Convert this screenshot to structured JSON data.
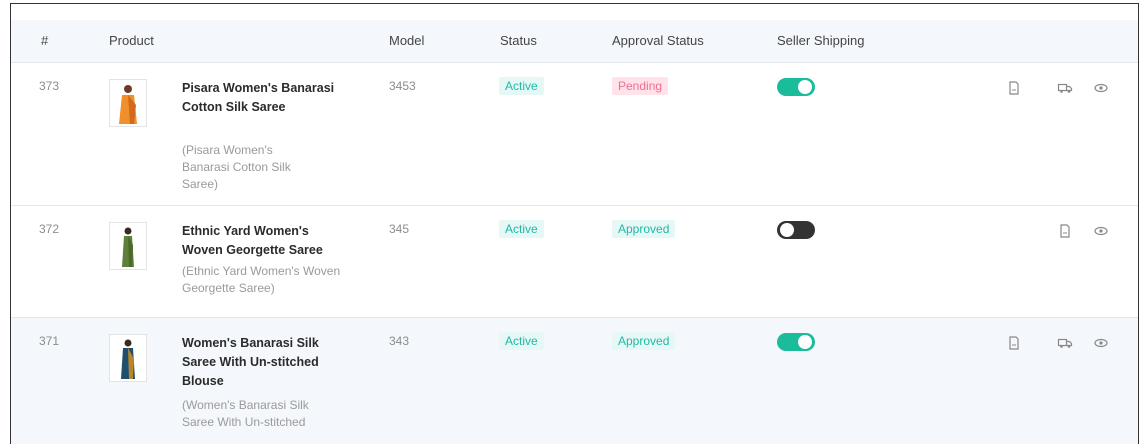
{
  "table": {
    "headers": {
      "id": "#",
      "product": "Product",
      "model": "Model",
      "status": "Status",
      "approval": "Approval Status",
      "shipping": "Seller Shipping"
    },
    "rows": [
      {
        "id": "373",
        "title": "Pisara Women's Banarasi Cotton Silk Saree",
        "subtitle": "(Pisara Women's Banarasi Cotton Silk Saree)",
        "model": "3453",
        "status": "Active",
        "approval": "Pending",
        "seller_shipping": true,
        "actions": [
          "document-icon",
          "truck-icon",
          "eye-icon"
        ]
      },
      {
        "id": "372",
        "title": "Ethnic Yard Women's Woven Georgette Saree",
        "subtitle": "(Ethnic Yard Women's Woven Georgette Saree)",
        "model": "345",
        "status": "Active",
        "approval": "Approved",
        "seller_shipping": false,
        "actions": [
          "document-icon",
          "eye-icon"
        ]
      },
      {
        "id": "371",
        "title": "Women's Banarasi Silk Saree With Un-stitched Blouse",
        "subtitle": "(Women's Banarasi Silk Saree With Un-stitched",
        "model": "343",
        "status": "Active",
        "approval": "Approved",
        "seller_shipping": true,
        "actions": [
          "document-icon",
          "truck-icon",
          "eye-icon"
        ]
      }
    ]
  },
  "colors": {
    "accent": "#1abc9c",
    "active_text": "#21b9a6",
    "pending_bg": "#ffe2ea",
    "pending_text": "#ee6f8f",
    "header_bg": "#f4f7fb"
  }
}
